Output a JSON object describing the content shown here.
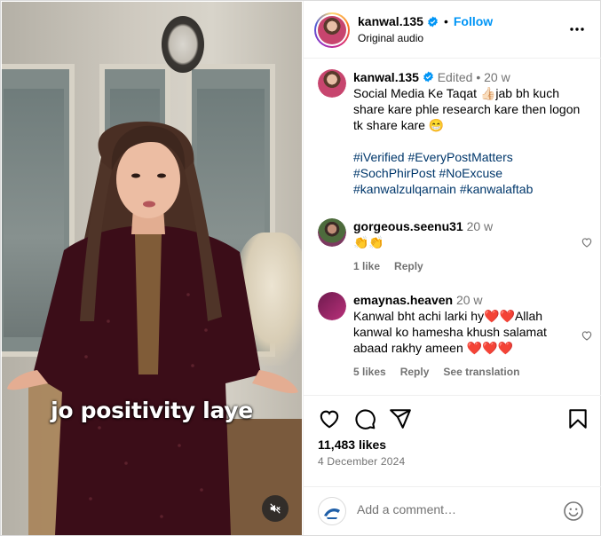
{
  "video": {
    "caption_overlay": "jo positivity laye"
  },
  "header": {
    "username": "kanwal.135",
    "follow_label": "Follow",
    "audio_label": "Original audio"
  },
  "caption": {
    "username": "kanwal.135",
    "edited": "Edited",
    "age": "20 w",
    "text_1": "Social Media Ke Taqat ",
    "emoji_1": "👍🏻",
    "text_2": "jab bh kuch share kare phle research kare then logon tk share kare ",
    "emoji_2": "😁",
    "hashtags": [
      "#iVerified",
      "#EveryPostMatters",
      "#SochPhirPost",
      "#NoExcuse",
      "#kanwalzulqarnain",
      "#kanwalaftab"
    ]
  },
  "comments": [
    {
      "username": "gorgeous.seenu31",
      "age": "20 w",
      "text": "👏👏",
      "likes": "1 like",
      "reply": "Reply"
    },
    {
      "username": "emaynas.heaven",
      "age": "20 w",
      "text": "Kanwal bht achi larki hy❤️❤️Allah kanwal ko hamesha khush salamat abaad rakhy ameen ❤️❤️❤️",
      "likes": "5 likes",
      "reply": "Reply",
      "translate": "See translation"
    }
  ],
  "footer": {
    "likes": "11,483 likes",
    "date": "4 December 2024",
    "add_comment_placeholder": "Add a comment…"
  },
  "colors": {
    "accent": "#0095f6",
    "hashtag": "#00376b",
    "muted": "#737373"
  },
  "icons": [
    "verified-badge-icon",
    "more-options-icon",
    "heart-icon",
    "comment-icon",
    "share-icon",
    "bookmark-icon",
    "mute-icon",
    "emoji-icon"
  ]
}
